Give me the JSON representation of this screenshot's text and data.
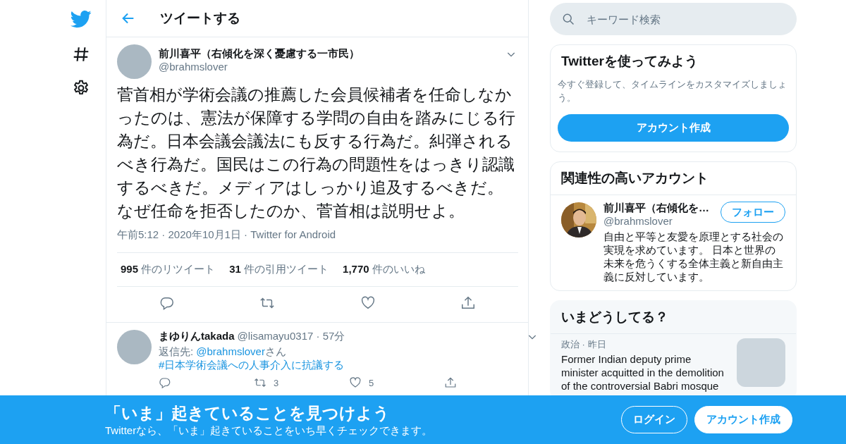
{
  "header": {
    "title": "ツイートする"
  },
  "search": {
    "placeholder": "キーワード検索"
  },
  "tweet": {
    "name": "前川喜平（右傾化を深く憂慮する一市民）",
    "handle": "@brahmslover",
    "text": "菅首相が学術会議の推薦した会員候補者を任命しなかったのは、憲法が保障する学問の自由を踏みにじる行為だ。日本会議会議法にも反する行為だ。糾弾されるべき行為だ。国民はこの行為の問題性をはっきり認識するべきだ。メディアはしっかり追及するべきだ。なぜ任命を拒否したのか、菅首相は説明せよ。",
    "timestamp": "午前5:12 · 2020年10月1日 · Twitter for Android",
    "stats": [
      {
        "count": "995",
        "label": "件のリツイート"
      },
      {
        "count": "31",
        "label": "件の引用ツイート"
      },
      {
        "count": "1,770",
        "label": "件のいいね"
      }
    ],
    "actions": [
      {
        "kind": "reply"
      },
      {
        "kind": "retweet"
      },
      {
        "kind": "like"
      },
      {
        "kind": "share"
      }
    ]
  },
  "reply": {
    "name": "まゆりんtakada",
    "meta": "@lisamayu0317 · 57分",
    "reply_to": "返信先:",
    "reply_handle": "@brahmslover",
    "reply_suffix": "さん",
    "hashtag": "#日本学術会議への人事介入に抗議する",
    "actions": [
      {
        "kind": "reply"
      },
      {
        "kind": "retweet",
        "count": "3"
      },
      {
        "kind": "like",
        "count": "5"
      },
      {
        "kind": "share"
      }
    ]
  },
  "signup": {
    "title": "Twitterを使ってみよう",
    "text": "今すぐ登録して、タイムラインをカスタマイズしましょう。",
    "button": "アカウント作成"
  },
  "who_to_follow": {
    "title": "関連性の高いアカウント",
    "accounts": [
      {
        "name": "前川喜平（右傾化を…",
        "handle": "@brahmslover",
        "bio": "自由と平等と友愛を原理とする社会の実現を求めています。 日本と世界の未来を危うくする全体主義と新自由主義に反対しています。",
        "button": "フォロー"
      }
    ]
  },
  "trends": {
    "title": "いまどうしてる？",
    "items": [
      {
        "meta": "政治 · 昨日",
        "text": "Former Indian deputy prime minister acquitted in the demolition of the controversial Babri mosque"
      }
    ]
  },
  "banner": {
    "title": "「いま」起きていることを見つけよう",
    "subtitle": "Twitterなら、「いま」起きていることをいち早くチェックできます。",
    "buttons": [
      {
        "label": "ログイン",
        "kind": "outline"
      },
      {
        "label": "アカウント作成",
        "kind": "filled"
      }
    ]
  }
}
